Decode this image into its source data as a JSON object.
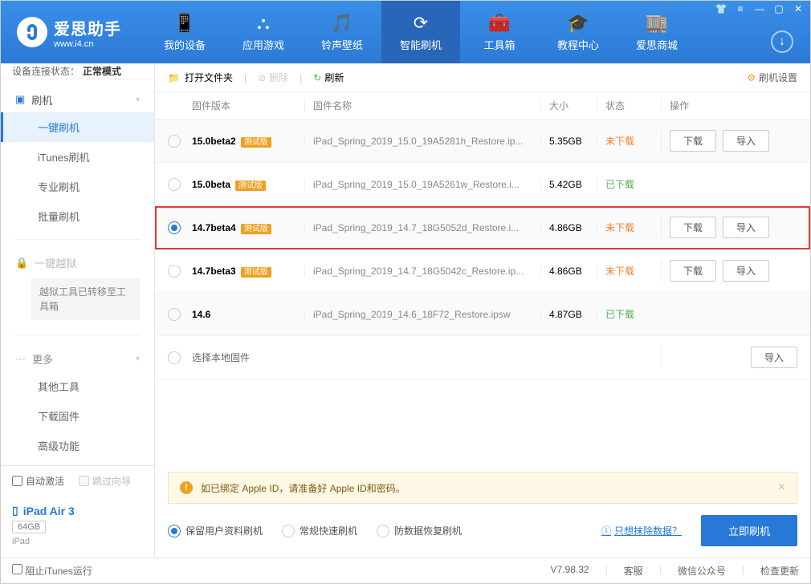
{
  "brand": {
    "title": "爱思助手",
    "sub": "www.i4.cn"
  },
  "nav": {
    "items": [
      "我的设备",
      "应用游戏",
      "铃声壁纸",
      "智能刷机",
      "工具箱",
      "教程中心",
      "爱思商城"
    ]
  },
  "connection": {
    "label": "设备连接状态：",
    "value": "正常模式"
  },
  "sidebar": {
    "flash_head": "刷机",
    "flash_items": [
      "一键刷机",
      "iTunes刷机",
      "专业刷机",
      "批量刷机"
    ],
    "jailbreak_head": "一键越狱",
    "jailbreak_note": "越狱工具已转移至工具箱",
    "more_head": "更多",
    "more_items": [
      "其他工具",
      "下载固件",
      "高级功能"
    ],
    "auto_activate": "自动激活",
    "skip_guide": "跳过向导",
    "device_name": "iPad Air 3",
    "device_storage": "64GB",
    "device_type": "iPad"
  },
  "toolbar": {
    "open": "打开文件夹",
    "delete": "删除",
    "refresh": "刷新",
    "settings": "刷机设置"
  },
  "columns": {
    "version": "固件版本",
    "name": "固件名称",
    "size": "大小",
    "status": "状态",
    "ops": "操作"
  },
  "beta_label": "测试版",
  "btn_download": "下载",
  "btn_import": "导入",
  "status_not": "未下载",
  "status_done": "已下载",
  "rows": [
    {
      "version": "15.0beta2",
      "beta": true,
      "name": "iPad_Spring_2019_15.0_19A5281h_Restore.ip...",
      "size": "5.35GB",
      "downloaded": false,
      "selected": false,
      "ops": true
    },
    {
      "version": "15.0beta",
      "beta": true,
      "name": "iPad_Spring_2019_15.0_19A5261w_Restore.i...",
      "size": "5.42GB",
      "downloaded": true,
      "selected": false,
      "ops": false
    },
    {
      "version": "14.7beta4",
      "beta": true,
      "name": "iPad_Spring_2019_14.7_18G5052d_Restore.i...",
      "size": "4.86GB",
      "downloaded": false,
      "selected": true,
      "ops": true,
      "highlight": true
    },
    {
      "version": "14.7beta3",
      "beta": true,
      "name": "iPad_Spring_2019_14.7_18G5042c_Restore.ip...",
      "size": "4.86GB",
      "downloaded": false,
      "selected": false,
      "ops": true
    },
    {
      "version": "14.6",
      "beta": false,
      "name": "iPad_Spring_2019_14.6_18F72_Restore.ipsw",
      "size": "4.87GB",
      "downloaded": true,
      "selected": false,
      "ops": false
    }
  ],
  "local_row": {
    "label": "选择本地固件"
  },
  "notice": "如已绑定 Apple ID，请准备好 Apple ID和密码。",
  "flash_options": [
    "保留用户资料刷机",
    "常规快速刷机",
    "防数据恢复刷机"
  ],
  "erase_link": "只想抹除数据？",
  "flash_now": "立即刷机",
  "footer": {
    "block_itunes": "阻止iTunes运行",
    "version": "V7.98.32",
    "service": "客服",
    "wechat": "微信公众号",
    "update": "检查更新"
  }
}
